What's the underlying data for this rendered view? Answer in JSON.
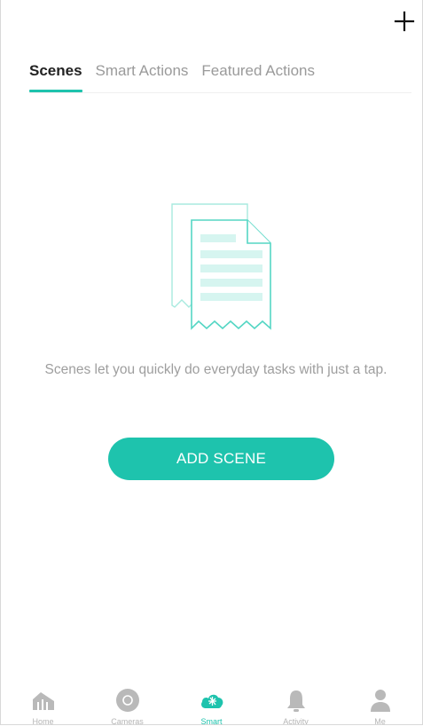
{
  "header": {
    "add_icon": "plus-icon"
  },
  "tabs": [
    {
      "label": "Scenes",
      "active": true
    },
    {
      "label": "Smart Actions",
      "active": false
    },
    {
      "label": "Featured Actions",
      "active": false
    }
  ],
  "empty_state": {
    "illustration_icon": "document-receipt-icon",
    "message": "Scenes let you quickly do everyday tasks with just a tap.",
    "button_label": "ADD SCENE"
  },
  "tabbar": {
    "items": [
      {
        "label": "Home",
        "icon": "home-icon",
        "active": false
      },
      {
        "label": "Cameras",
        "icon": "camera-icon",
        "active": false
      },
      {
        "label": "Smart",
        "icon": "smart-icon",
        "active": true
      },
      {
        "label": "Activity",
        "icon": "bell-icon",
        "active": false
      },
      {
        "label": "Me",
        "icon": "person-icon",
        "active": false
      }
    ]
  },
  "colors": {
    "accent": "#1ec3ad",
    "inactive_icon": "#b9b9b9",
    "illustration_stroke": "#8fe3d6",
    "illustration_fill": "#d6f5f0"
  }
}
